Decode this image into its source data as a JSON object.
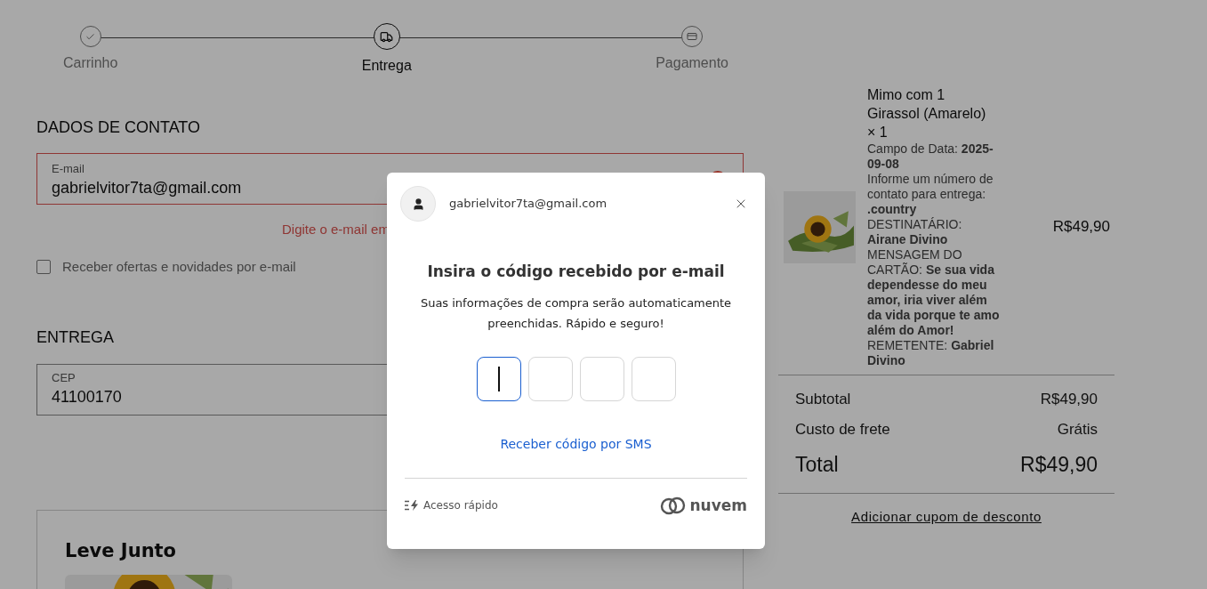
{
  "stepper": [
    {
      "label": "Carrinho",
      "selected": false
    },
    {
      "label": "Entrega",
      "selected": true
    },
    {
      "label": "Pagamento",
      "selected": false
    }
  ],
  "contact": {
    "heading": "DADOS DE CONTATO",
    "email_field": {
      "label": "E-mail",
      "value": "gabrielvitor7ta@gmail.com",
      "error": true
    },
    "error_message": "Digite o e-mail em",
    "newsletter": {
      "label": "Receber ofertas e novidades por e-mail",
      "checked": false
    }
  },
  "delivery": {
    "heading": "ENTREGA",
    "cep_field": {
      "label": "CEP",
      "value": "41100170"
    }
  },
  "upsell": {
    "title": "Leve Junto"
  },
  "cart": {
    "item": {
      "title": "Mimo com 1 Girassol (Amarelo)",
      "quantity": "× 1",
      "details": [
        "Campo de Data: **2025-09-08**",
        "Informe um número de contato para entrega: **.country**",
        "DESTINATÁRIO: **Airane Divino**",
        "MENSAGEM DO CARTÃO: **Se sua vida dependesse do meu amor, iria viver além da vida porque te amo além do Amor!**",
        "REMETENTE: **Gabriel Divino**"
      ],
      "price": "R$49,90"
    },
    "totals": [
      {
        "label": "Subtotal",
        "value": "R$49,90",
        "kind": "line"
      },
      {
        "label": "Custo de frete",
        "value": "Grátis",
        "kind": "line"
      },
      {
        "label": "Total",
        "value": "R$49,90",
        "kind": "total"
      }
    ],
    "coupon_link": "Adicionar cupom de desconto"
  },
  "modal": {
    "account_email": "gabrielvitor7ta@gmail.com",
    "title": "Insira o código recebido por e-mail",
    "subtitle": "Suas informações de compra serão automaticamente preenchidas. Rápido e seguro!",
    "code_boxes": [
      {
        "focused": true
      },
      {
        "focused": false
      },
      {
        "focused": false
      },
      {
        "focused": false
      }
    ],
    "sms_link": "Receber código por SMS",
    "footer_label": "Acesso rápido",
    "brand": "nuvem"
  }
}
